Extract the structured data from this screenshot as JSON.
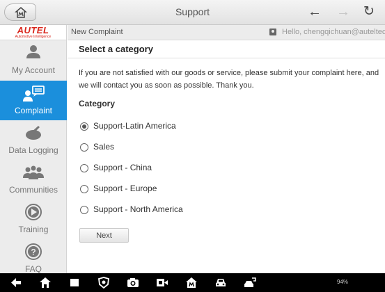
{
  "topbar": {
    "title": "Support"
  },
  "sidebar": {
    "logo": "AUTEL",
    "logo_sub": "Automotive Intelligence",
    "items": [
      {
        "label": "My Account",
        "icon": "person-icon",
        "active": false
      },
      {
        "label": "Complaint",
        "icon": "complaint-icon",
        "active": true
      },
      {
        "label": "Data Logging",
        "icon": "data-logging-icon",
        "active": false
      },
      {
        "label": "Communities",
        "icon": "communities-icon",
        "active": false
      },
      {
        "label": "Training",
        "icon": "play-icon",
        "active": false
      },
      {
        "label": "FAQ",
        "icon": "question-icon",
        "active": false
      }
    ]
  },
  "main": {
    "breadcrumb": "New Complaint",
    "greeting": "Hello, chengqichuan@auteltech.net",
    "section_title": "Select a category",
    "intro": "If you are not satisfied with our goods or service, please submit your complaint here, and we will contact you as soon as possible. Thank you.",
    "category_label": "Category",
    "categories": [
      {
        "label": "Support-Latin America",
        "checked": true
      },
      {
        "label": "Sales",
        "checked": false
      },
      {
        "label": "Support - China",
        "checked": false
      },
      {
        "label": "Support - Europe",
        "checked": false
      },
      {
        "label": "Support - North America",
        "checked": false
      }
    ],
    "next_label": "Next"
  },
  "statusbar": {
    "text": "94%"
  },
  "colors": {
    "accent": "#1b8fdc",
    "brand": "#d9261c"
  }
}
